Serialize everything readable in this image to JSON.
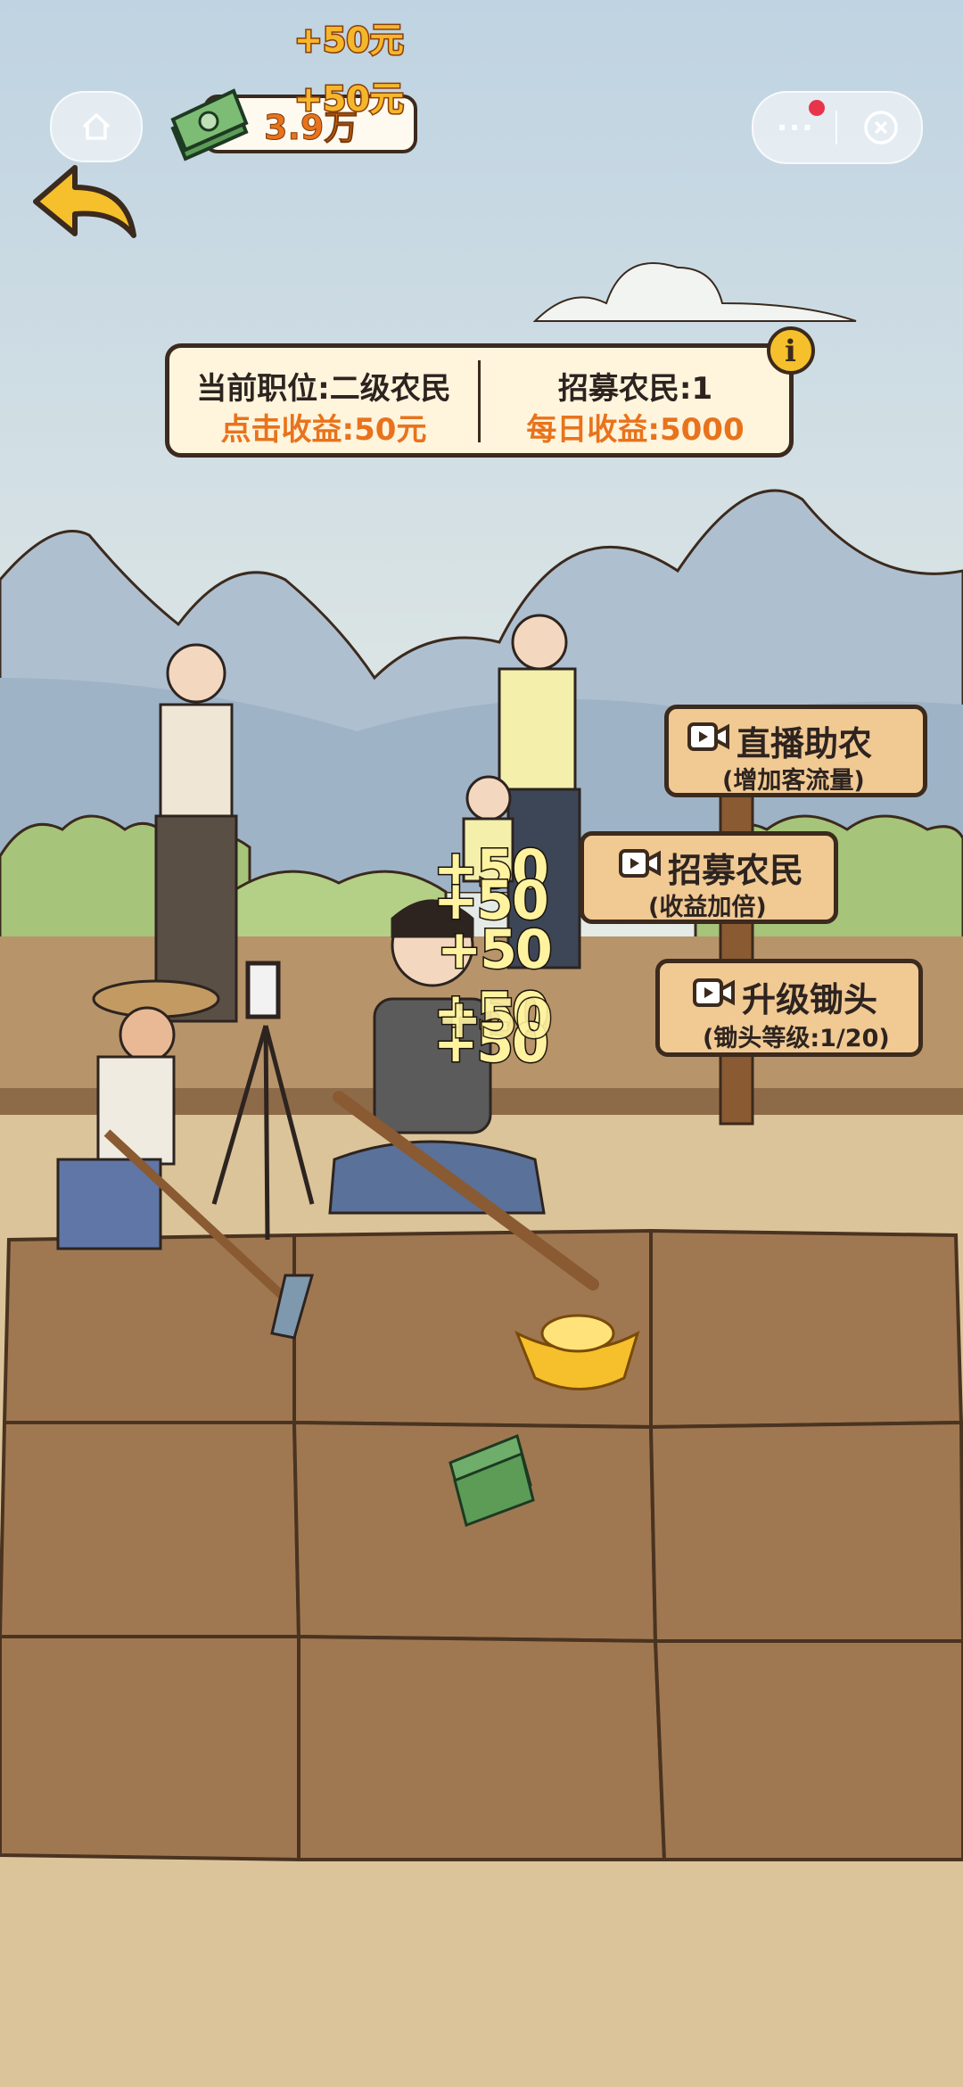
{
  "hud": {
    "money_value": "3.9万",
    "floating_gain_1": "+50元",
    "floating_gain_2": "+50元"
  },
  "info_panel": {
    "position_label": "当前职位:二级农民",
    "click_income": "点击收益:50元",
    "recruited": "招募农民:1",
    "daily_income": "每日收益:5000"
  },
  "signs": [
    {
      "title": "直播助农",
      "subtitle": "(增加客流量)"
    },
    {
      "title": "招募农民",
      "subtitle": "(收益加倍)"
    },
    {
      "title": "升级锄头",
      "subtitle": "(锄头等级:1/20)"
    }
  ],
  "click_popups": [
    "+50",
    "+50",
    "+50",
    "+50",
    "+50",
    "+50"
  ],
  "colors": {
    "sky": "#dde6e6",
    "mountain": "#aebfd0",
    "soil": "#9f7852",
    "sand": "#dcc49a",
    "accent_orange": "#e8731c",
    "gold": "#f5b62b"
  }
}
